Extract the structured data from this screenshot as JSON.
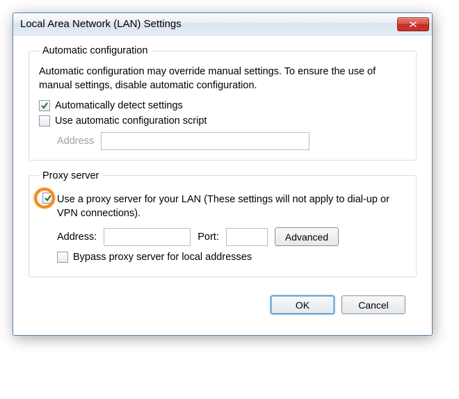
{
  "window": {
    "title": "Local Area Network (LAN) Settings"
  },
  "auto": {
    "legend": "Automatic configuration",
    "desc": "Automatic configuration may override manual settings.  To ensure the use of manual settings, disable automatic configuration.",
    "detect_label": "Automatically detect settings",
    "script_label": "Use automatic configuration script",
    "address_label": "Address",
    "detect_checked": true,
    "script_checked": false
  },
  "proxy": {
    "legend": "Proxy server",
    "desc": "Use a proxy server for your LAN (These settings will not apply to dial-up or VPN connections).",
    "use_checked": true,
    "address_label": "Address:",
    "address_value": "",
    "port_label": "Port:",
    "port_value": "",
    "advanced_label": "Advanced",
    "bypass_label": "Bypass proxy server for local addresses",
    "bypass_checked": false
  },
  "buttons": {
    "ok": "OK",
    "cancel": "Cancel"
  }
}
